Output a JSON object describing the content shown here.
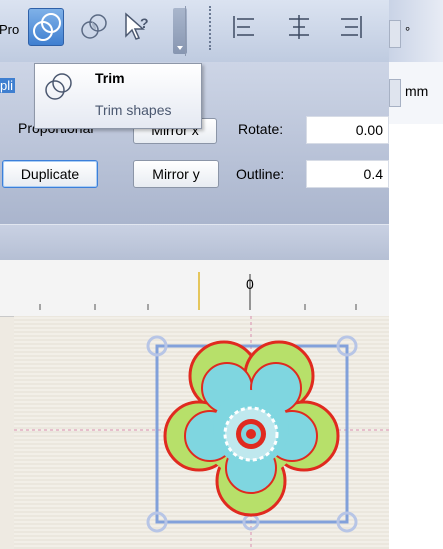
{
  "toolbar": {
    "left_label": "Pro",
    "mid_label": "Mirror x",
    "tools": [
      {
        "name": "trim-tool",
        "icon": "trim-icon"
      },
      {
        "name": "intersect-tool",
        "icon": "intersect-icon"
      },
      {
        "name": "help-tool",
        "icon": "help-cursor-icon"
      }
    ],
    "align": [
      "align-left-icon",
      "align-center-icon",
      "align-right-icon"
    ]
  },
  "tooltip": {
    "title": "Trim",
    "description": "Trim shapes"
  },
  "panel": {
    "left_clipped_label": "pli",
    "proportional_label": "Proportional",
    "mirror_x_label": "Mirror x",
    "duplicate_label": "Duplicate",
    "mirror_y_label": "Mirror y",
    "rotate_label": "Rotate:",
    "rotate_value": "0.00",
    "outline_label": "Outline:",
    "outline_value": "0.4",
    "degree_unit": "°",
    "mm_unit": "mm"
  },
  "ruler": {
    "zero_label": "0"
  },
  "colors": {
    "accent_blue": "#3f7fd0",
    "selection_blue": "#6f93d8",
    "petal_outline_red": "#e02a1f",
    "petal_green": "#b7e06a",
    "petal_cyan": "#7fd6e0"
  }
}
